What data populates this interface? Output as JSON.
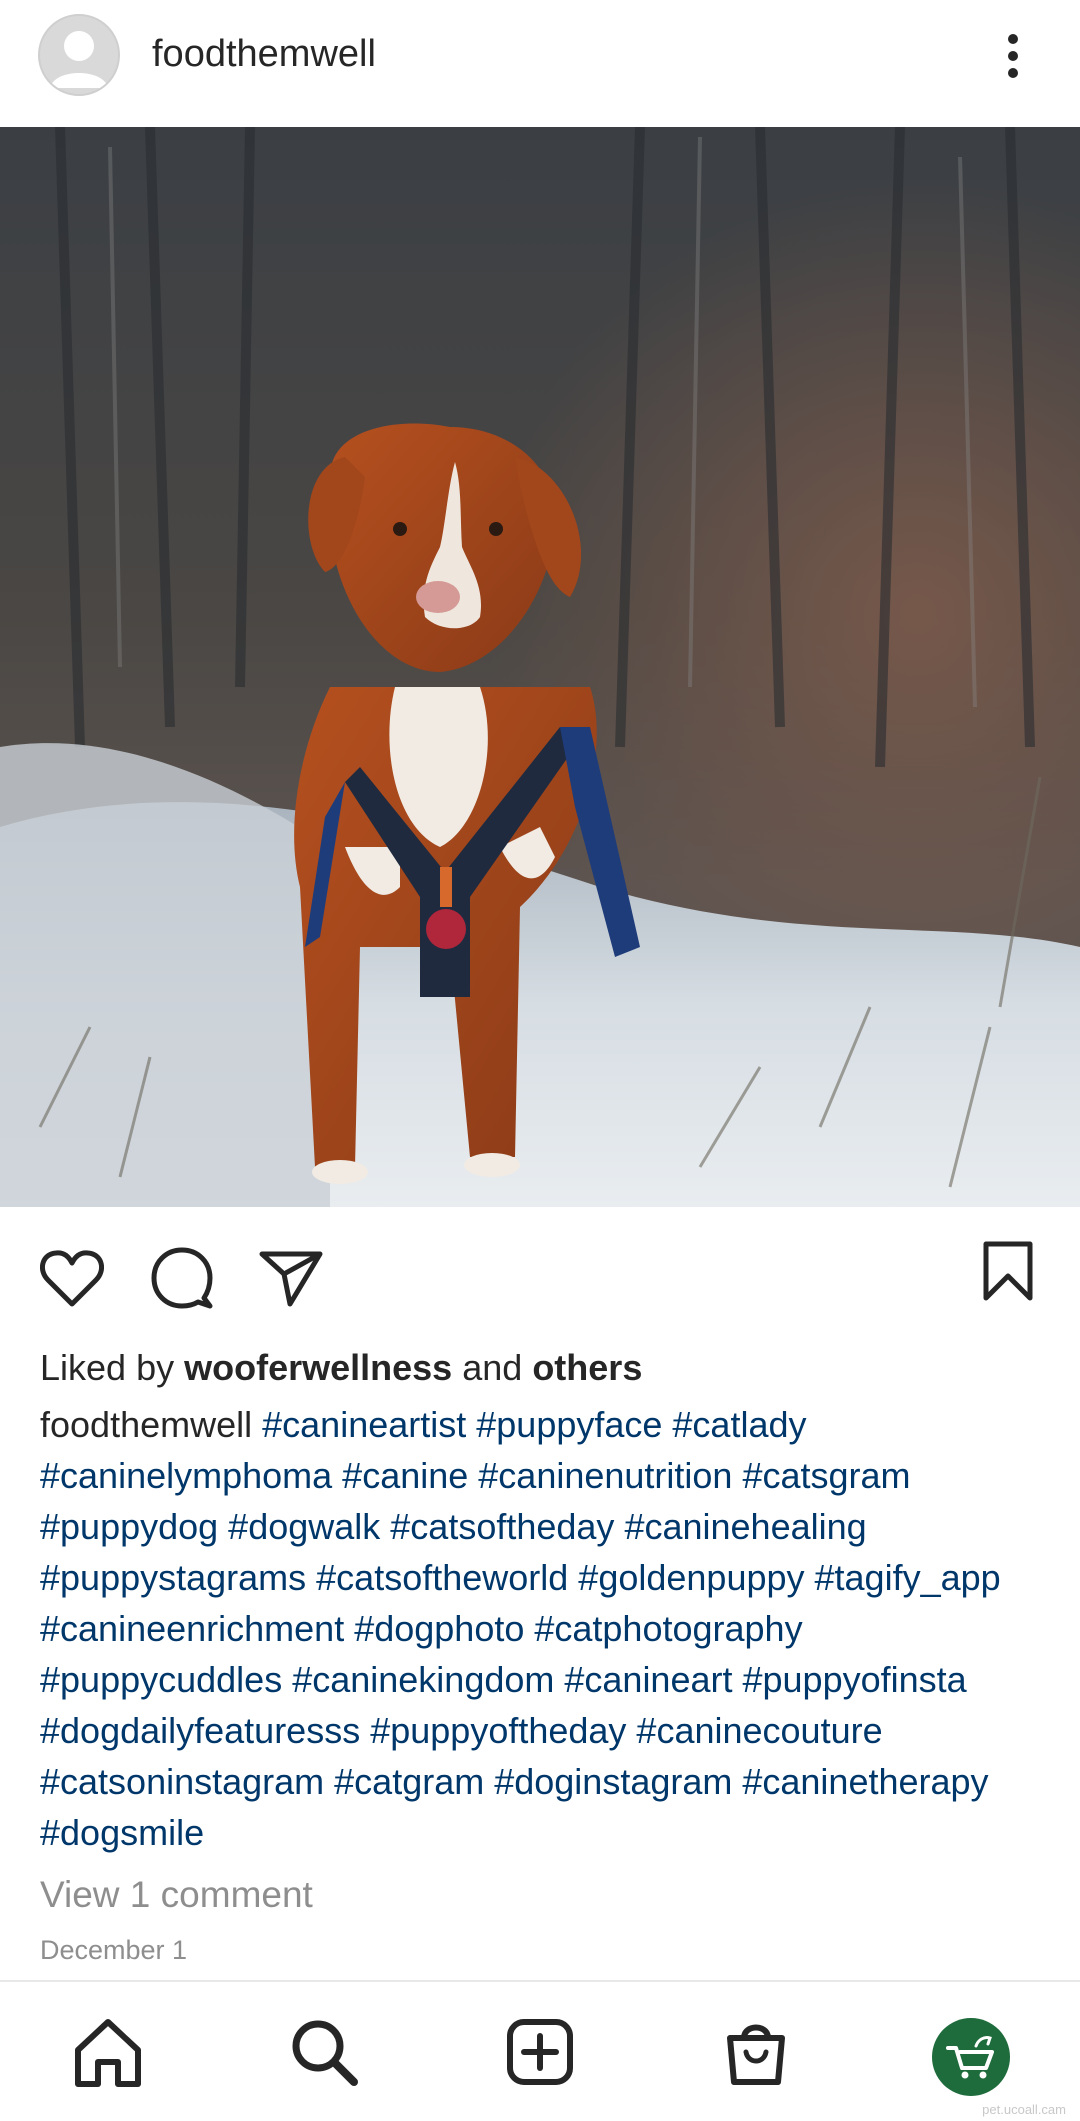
{
  "post": {
    "username": "foodthemwell",
    "liked_by_prefix": "Liked by",
    "liked_by_user": "wooferwellness",
    "liked_by_and": "and",
    "liked_by_others": "others",
    "caption_user": "foodthemwell",
    "hashtags": "#canineartist #puppyface #catlady #caninelymphoma #canine #caninenutrition #catsgram #puppydog #dogwalk #catsoftheday #caninehealing #puppystagrams #catsoftheworld #goldenpuppy #tagify_app #canineenrichment #dogphoto #catphotography #puppycuddles #caninekingdom #canineart #puppyofinsta #dogdailyfeaturesss #puppyoftheday #caninecouture #catsoninstagram #catgram #doginstagram #caninetherapy #dogsmile",
    "view_comments": "View 1 comment",
    "date": "December 1"
  },
  "icons": {
    "more": "more-vertical-icon",
    "like": "heart-icon",
    "comment": "comment-icon",
    "share": "send-icon",
    "save": "bookmark-icon",
    "home": "home-icon",
    "search": "search-icon",
    "create": "plus-square-icon",
    "shop": "shopping-bag-icon",
    "brand": "cart-dog-logo"
  },
  "colors": {
    "hashtag": "#00376b",
    "muted": "#8e8e8e",
    "brand_green": "#1e6b3c"
  },
  "watermark": "pet.ucoall.cam"
}
